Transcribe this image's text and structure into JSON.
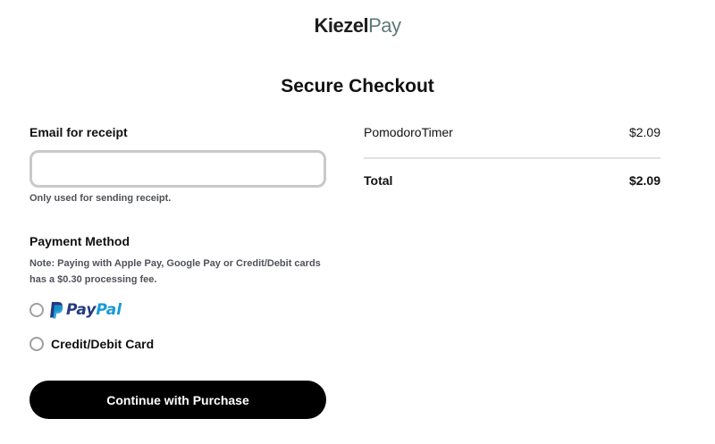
{
  "brand": {
    "name_part1": "Kiezel",
    "name_part2": "Pay"
  },
  "page": {
    "title": "Secure Checkout"
  },
  "form": {
    "email_label": "Email for receipt",
    "email_value": "",
    "email_hint": "Only used for sending receipt.",
    "payment_method_label": "Payment Method",
    "payment_note": "Note: Paying with Apple Pay, Google Pay or Credit/Debit cards has a $0.30 processing fee.",
    "options": [
      {
        "id": "paypal",
        "logo_text_part1": "Pay",
        "logo_text_part2": "Pal",
        "selected": false
      },
      {
        "id": "card",
        "label": "Credit/Debit Card",
        "selected": false
      }
    ],
    "continue_label": "Continue with Purchase"
  },
  "summary": {
    "items": [
      {
        "name": "PomodoroTimer",
        "price": "$2.09"
      }
    ],
    "total_label": "Total",
    "total_value": "$2.09"
  },
  "colors": {
    "brand_dark": "#1d1d1d",
    "brand_accent": "#5d7a77",
    "button_bg": "#000000",
    "paypal_dark": "#253b80",
    "paypal_light": "#179bd7"
  }
}
